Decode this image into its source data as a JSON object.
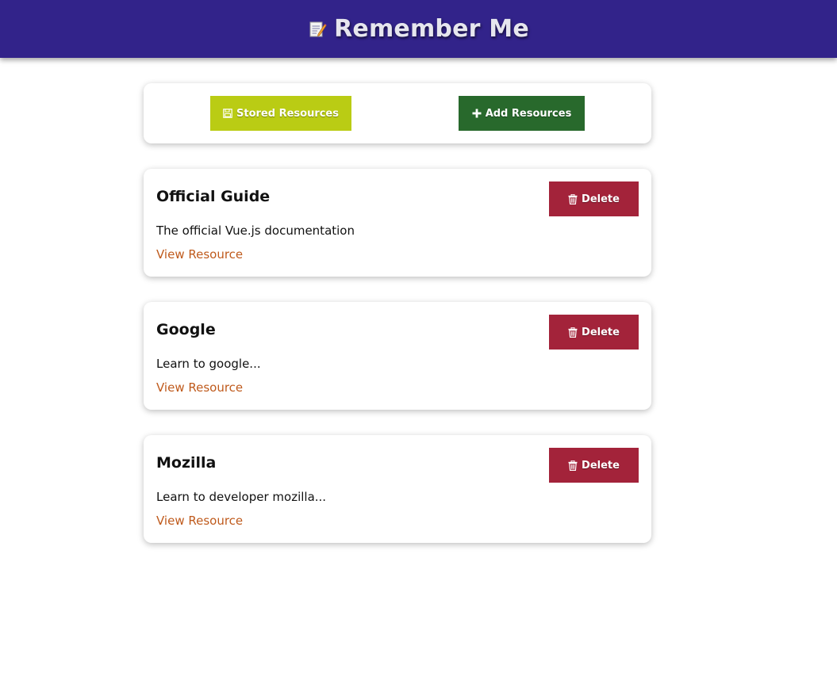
{
  "header": {
    "title": "Remember Me",
    "icon": "memo-icon"
  },
  "nav": {
    "stored_label": "Stored Resources",
    "add_label": "Add Resources",
    "colors": {
      "stored": "#bacc14",
      "add": "#28692c"
    }
  },
  "resources": [
    {
      "title": "Official Guide",
      "description": "The official Vue.js documentation",
      "link_label": "View Resource",
      "delete_label": "Delete"
    },
    {
      "title": "Google",
      "description": "Learn to google...",
      "link_label": "View Resource",
      "delete_label": "Delete"
    },
    {
      "title": "Mozilla",
      "description": "Learn to developer mozilla...",
      "link_label": "View Resource",
      "delete_label": "Delete"
    }
  ],
  "colors": {
    "header_bg": "#32238a",
    "delete": "#a3233a",
    "link": "#bf5a1c"
  }
}
